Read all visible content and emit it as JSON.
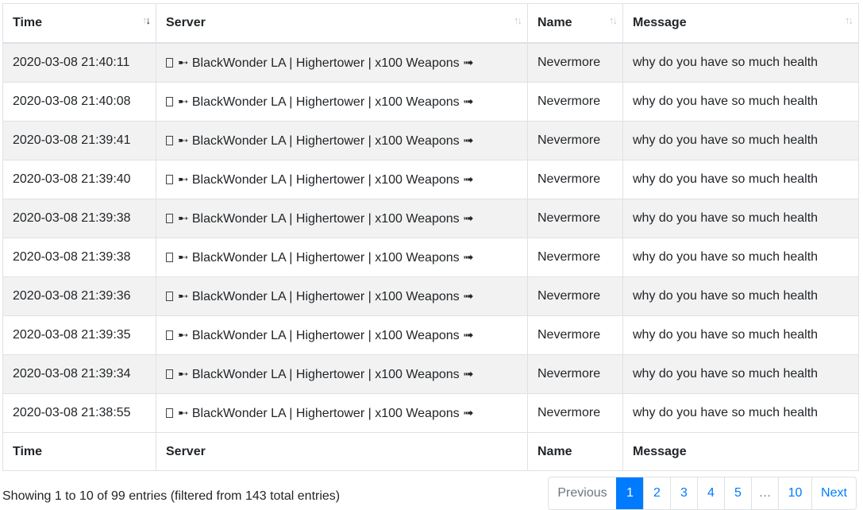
{
  "table": {
    "columns": [
      {
        "label": "Time",
        "sort": "desc"
      },
      {
        "label": "Server",
        "sort": "none"
      },
      {
        "label": "Name",
        "sort": "none"
      },
      {
        "label": "Message",
        "sort": "none"
      }
    ],
    "rows": [
      {
        "time": "2020-03-08 21:40:11",
        "server": "➸ BlackWonder LA | Highertower | x100 Weapons ➟",
        "name": "Nevermore",
        "message": "why do you have so much health"
      },
      {
        "time": "2020-03-08 21:40:08",
        "server": "➸ BlackWonder LA | Highertower | x100 Weapons ➟",
        "name": "Nevermore",
        "message": "why do you have so much health"
      },
      {
        "time": "2020-03-08 21:39:41",
        "server": "➸ BlackWonder LA | Highertower | x100 Weapons ➟",
        "name": "Nevermore",
        "message": "why do you have so much health"
      },
      {
        "time": "2020-03-08 21:39:40",
        "server": "➸ BlackWonder LA | Highertower | x100 Weapons ➟",
        "name": "Nevermore",
        "message": "why do you have so much health"
      },
      {
        "time": "2020-03-08 21:39:38",
        "server": "➸ BlackWonder LA | Highertower | x100 Weapons ➟",
        "name": "Nevermore",
        "message": "why do you have so much health"
      },
      {
        "time": "2020-03-08 21:39:38",
        "server": "➸ BlackWonder LA | Highertower | x100 Weapons ➟",
        "name": "Nevermore",
        "message": "why do you have so much health"
      },
      {
        "time": "2020-03-08 21:39:36",
        "server": "➸ BlackWonder LA | Highertower | x100 Weapons ➟",
        "name": "Nevermore",
        "message": "why do you have so much health"
      },
      {
        "time": "2020-03-08 21:39:35",
        "server": "➸ BlackWonder LA | Highertower | x100 Weapons ➟",
        "name": "Nevermore",
        "message": "why do you have so much health"
      },
      {
        "time": "2020-03-08 21:39:34",
        "server": "➸ BlackWonder LA | Highertower | x100 Weapons ➟",
        "name": "Nevermore",
        "message": "why do you have so much health"
      },
      {
        "time": "2020-03-08 21:38:55",
        "server": "➸ BlackWonder LA | Highertower | x100 Weapons ➟",
        "name": "Nevermore",
        "message": "why do you have so much health"
      }
    ],
    "footer": [
      "Time",
      "Server",
      "Name",
      "Message"
    ]
  },
  "info_text": "Showing 1 to 10 of 99 entries (filtered from 143 total entries)",
  "pagination": {
    "previous_label": "Previous",
    "pages": [
      "1",
      "2",
      "3",
      "4",
      "5",
      "…",
      "10"
    ],
    "active_page": "1",
    "next_label": "Next"
  },
  "colors": {
    "accent": "#007bff",
    "stripe": "#f2f2f2",
    "border": "#dee2e6"
  },
  "icons": {
    "sort_indicator": "sort-arrows-icon",
    "server_glyph": "square-glyph-icon"
  }
}
